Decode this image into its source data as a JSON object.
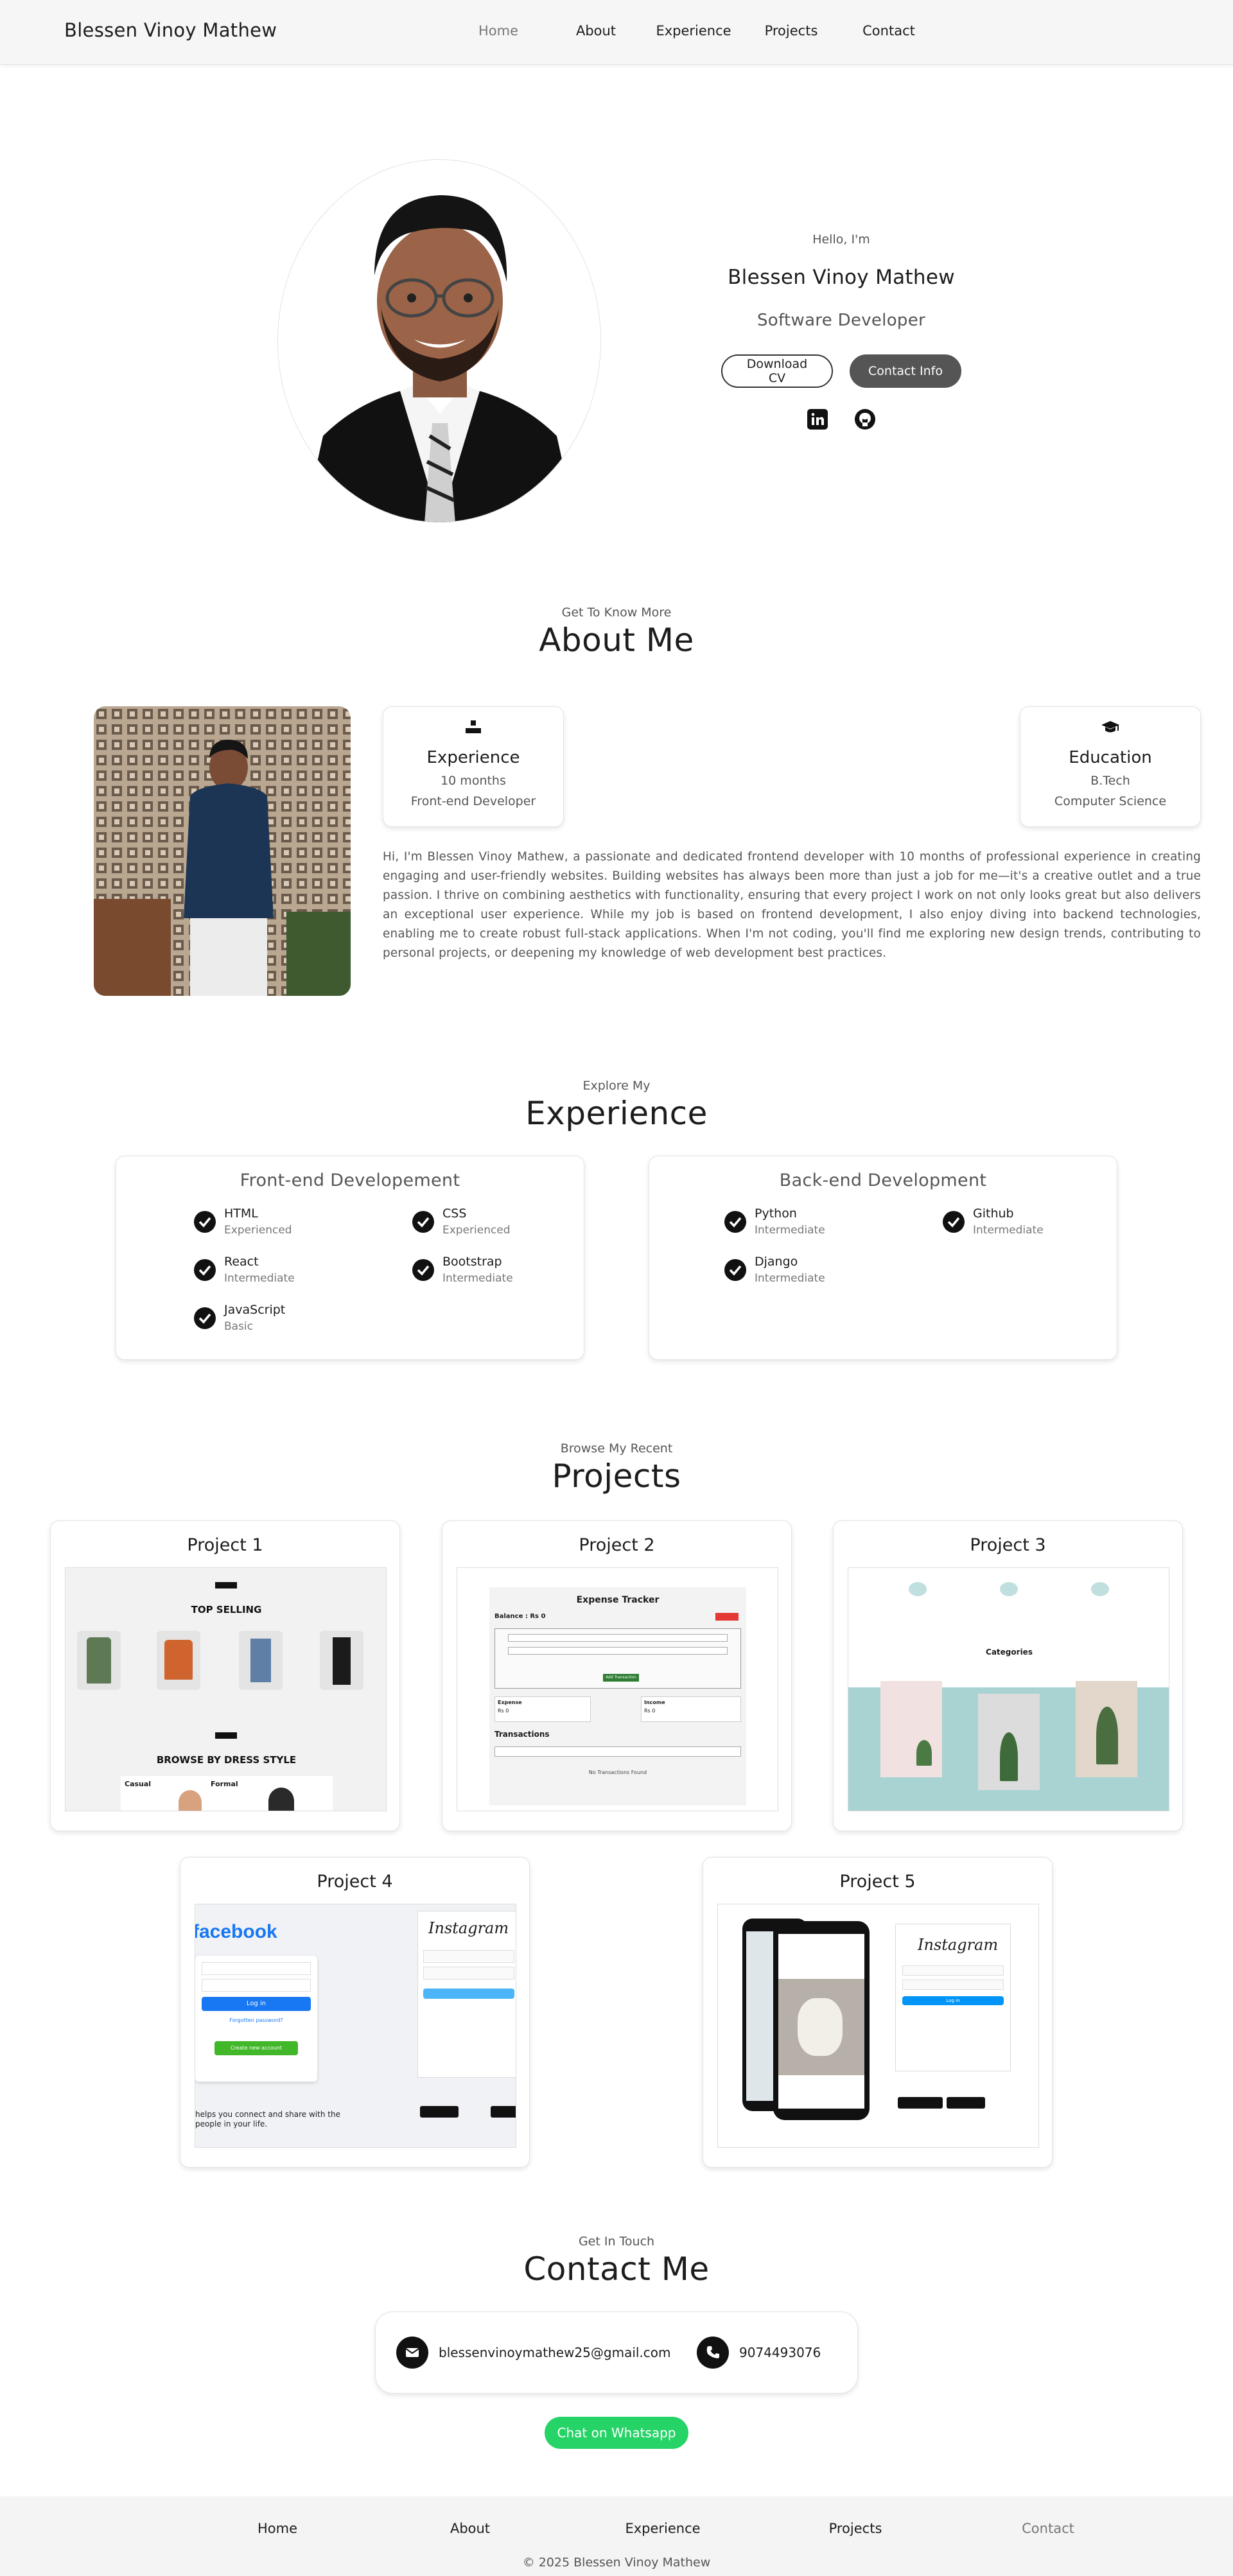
{
  "nav": {
    "brand": "Blessen Vinoy Mathew",
    "links": [
      "Home",
      "About",
      "Experience",
      "Projects",
      "Contact"
    ]
  },
  "profile": {
    "greeting": "Hello, I'm",
    "name": "Blessen Vinoy Mathew",
    "role": "Software Developer",
    "download_cv": "Download CV",
    "contact_info": "Contact Info",
    "social_icons": [
      "linkedin-icon",
      "github-icon"
    ]
  },
  "about": {
    "subtitle": "Get To Know More",
    "title": "About Me",
    "experience": {
      "heading": "Experience",
      "line1": "10 months",
      "line2": "Front-end Developer"
    },
    "education": {
      "heading": "Education",
      "line1": "B.Tech",
      "line2": "Computer Science"
    },
    "text": "Hi, I'm Blessen Vinoy Mathew, a passionate and dedicated frontend developer with 10 months of professional experience in creating engaging and user-friendly websites. Building websites has always been more than just a job for me—it's a creative outlet and a true passion. I thrive on combining aesthetics with functionality, ensuring that every project I work on not only looks great but also delivers an exceptional user experience. While my job is based on frontend development, I also enjoy diving into backend technologies, enabling me to create robust full-stack applications. When I'm not coding, you'll find me exploring new design trends, contributing to personal projects, or deepening my knowledge of web development best practices."
  },
  "experience": {
    "subtitle": "Explore My",
    "title": "Experience",
    "frontend": {
      "heading": "Front-end Developement",
      "skills": [
        {
          "name": "HTML",
          "level": "Experienced"
        },
        {
          "name": "CSS",
          "level": "Experienced"
        },
        {
          "name": "React",
          "level": "Intermediate"
        },
        {
          "name": "Bootstrap",
          "level": "Intermediate"
        },
        {
          "name": "JavaScript",
          "level": "Basic"
        }
      ]
    },
    "backend": {
      "heading": "Back-end Development",
      "skills": [
        {
          "name": "Python",
          "level": "Intermediate"
        },
        {
          "name": "Github",
          "level": "Intermediate"
        },
        {
          "name": "Django",
          "level": "Intermediate"
        }
      ]
    }
  },
  "projects": {
    "subtitle": "Browse My Recent",
    "title": "Projects",
    "items": [
      {
        "title": "Project 1",
        "shot": {
          "heading": "TOP SELLING",
          "sub": "BROWSE BY DRESS STYLE",
          "tags": [
            "Casual",
            "Formal"
          ]
        }
      },
      {
        "title": "Project 2",
        "shot": {
          "heading": "Expense Tracker",
          "balance": "Balance : Rs 0",
          "col1": "Expense",
          "col2": "Income",
          "val1": "Rs 0",
          "val2": "Rs 0",
          "transactions": "Transactions",
          "empty": "No Transactions Found",
          "button": "Add Transaction"
        }
      },
      {
        "title": "Project 3",
        "shot": {
          "heading": "Categories"
        }
      },
      {
        "title": "Project 4",
        "shot": {
          "fb_logo": "facebook",
          "login": "Log in",
          "forgot": "Forgotten password?",
          "create": "Create new account",
          "tagline": "helps you connect and share with the people in your life.",
          "ig_logo": "Instagram"
        }
      },
      {
        "title": "Project 5",
        "shot": {
          "ig_logo": "Instagram",
          "login": "Log in"
        }
      }
    ]
  },
  "contact": {
    "subtitle": "Get In Touch",
    "title": "Contact Me",
    "email": "blessenvinoymathew25@gmail.com",
    "phone": "9074493076",
    "whatsapp": "Chat on Whatsapp"
  },
  "footer": {
    "links": [
      "Home",
      "About",
      "Experience",
      "Projects",
      "Contact"
    ],
    "copyright": "© 2025 Blessen Vinoy Mathew"
  },
  "colors": {
    "accent_dark": "#555555",
    "whatsapp_green": "#25d366",
    "text": "#1c1c1c",
    "muted": "#777777"
  }
}
